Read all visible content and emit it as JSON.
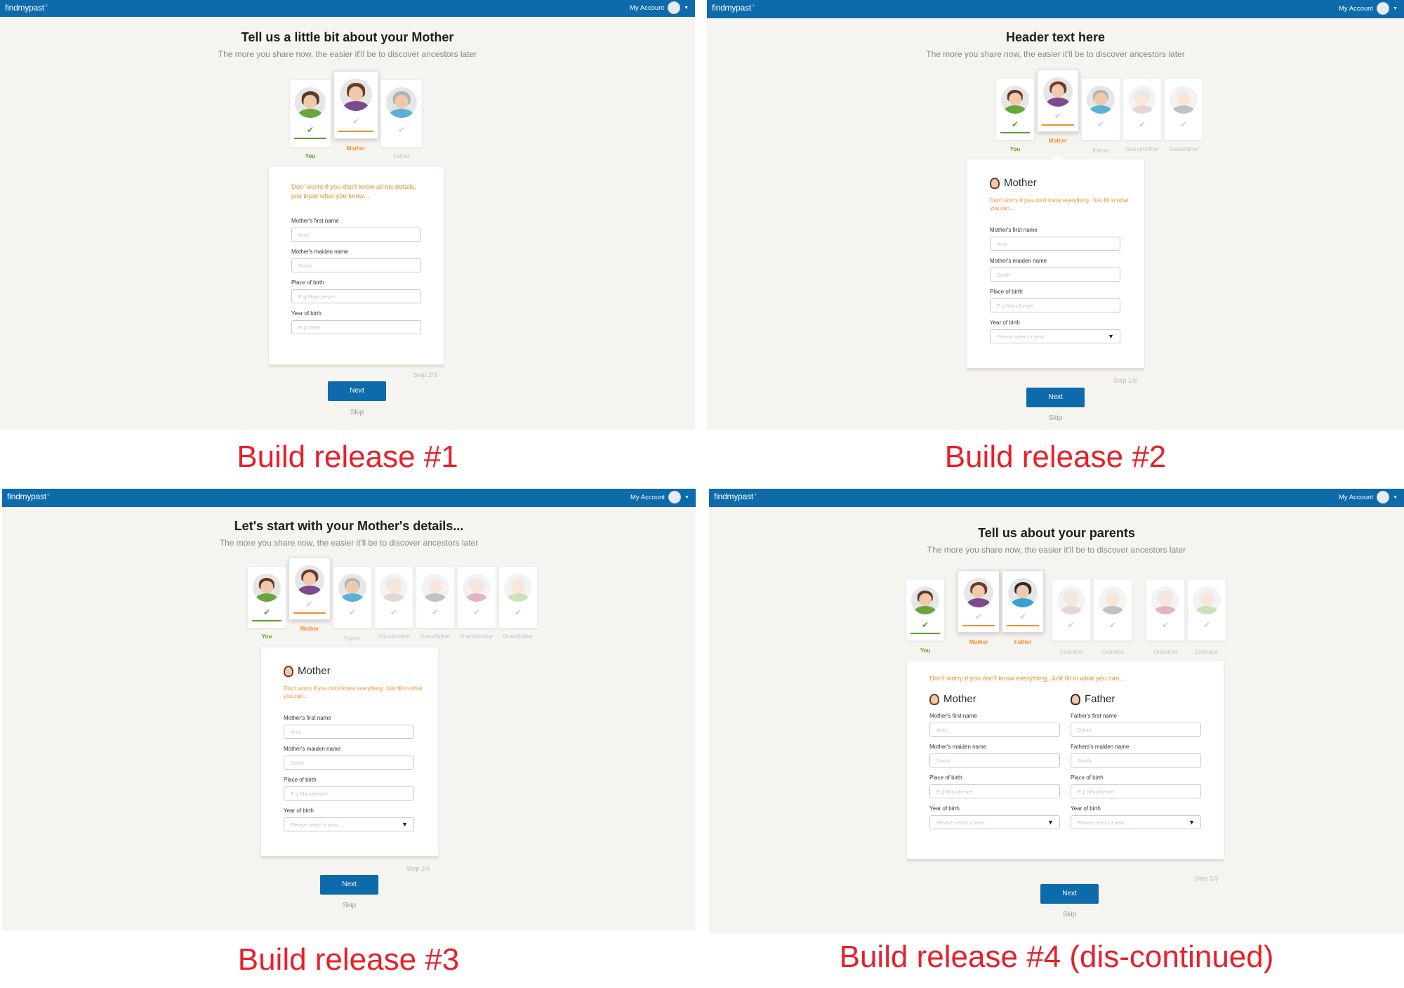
{
  "common": {
    "logo": "findmypast",
    "account": "My Account",
    "subtitle": "The more you share now, the easier it'll be to discover ancestors later",
    "next": "Next",
    "skip": "Skip"
  },
  "panel1": {
    "title": "Tell us a little bit about your Mother",
    "caption": "Build release #1",
    "step": "Step 2/3",
    "note": "Don' worry if you don't know all his details, just input what you know...",
    "members": [
      "You",
      "Mother",
      "Father"
    ],
    "fields": [
      {
        "label": "Mother's first name",
        "placeholder": "Amy"
      },
      {
        "label": "Mother's maiden name",
        "placeholder": "Smith"
      },
      {
        "label": "Place of birth",
        "placeholder": "E.g Manchester"
      },
      {
        "label": "Year of birth",
        "placeholder": "E.g 1969"
      }
    ]
  },
  "panel2": {
    "title": "Header text here",
    "caption": "Build release #2",
    "step": "Step 1/6",
    "form_title": "Mother",
    "note": "Don't worry if you don't know everything. Just fill in what you can...",
    "members": [
      "You",
      "Mother",
      "Father",
      "Grandmother",
      "Grandfather"
    ],
    "fields": [
      {
        "label": "Mother's first name",
        "placeholder": "Amy"
      },
      {
        "label": "Mother's maiden name",
        "placeholder": "Smith"
      },
      {
        "label": "Place of birth",
        "placeholder": "E.g Manchester"
      },
      {
        "label": "Year of birth",
        "placeholder": "Please select a year..."
      }
    ]
  },
  "panel3": {
    "title": "Let's start with your Mother's details...",
    "caption": "Build release #3",
    "step": "Step 2/6",
    "form_title": "Mother",
    "note": "Don't worry if you don't know everything. Just fill in what you can...",
    "members": [
      "You",
      "Mother",
      "Father",
      "Grandmother",
      "Grandfather",
      "Grandmother",
      "Grandfather"
    ],
    "fields": [
      {
        "label": "Mother's first name",
        "placeholder": "Amy"
      },
      {
        "label": "Mother's maiden name",
        "placeholder": "Smith"
      },
      {
        "label": "Place of birth",
        "placeholder": "E.g Manchester"
      },
      {
        "label": "Year of birth",
        "placeholder": "Please select a year..."
      }
    ]
  },
  "panel4": {
    "title": "Tell us about your parents",
    "caption": "Build release #4 (dis-continued)",
    "step": "Step 1/3",
    "note": "Don't worry if you don't know everything. Just fill in what you can...",
    "members": [
      "You",
      "Mother",
      "Father",
      "Grandma",
      "Grandpa",
      "Grandma",
      "Grandpa"
    ],
    "mother_title": "Mother",
    "father_title": "Father",
    "mother_fields": [
      {
        "label": "Mother's first name",
        "placeholder": "Amy"
      },
      {
        "label": "Mother's maiden name",
        "placeholder": "Smith"
      },
      {
        "label": "Place of birth",
        "placeholder": "E.g Manchester"
      },
      {
        "label": "Year of birth",
        "placeholder": "Please select a year..."
      }
    ],
    "father_fields": [
      {
        "label": "Father's first name",
        "placeholder": "Daniel"
      },
      {
        "label": "Fathers's maiden name",
        "placeholder": "Smith"
      },
      {
        "label": "Place of birth",
        "placeholder": "E.g Manchester"
      },
      {
        "label": "Year of birth",
        "placeholder": "Please select a year..."
      }
    ]
  },
  "colors": {
    "brand_blue": "#0d6aab",
    "accent_orange": "#f0902b",
    "check_green": "#52a32c",
    "caption_red": "#e8202a"
  }
}
